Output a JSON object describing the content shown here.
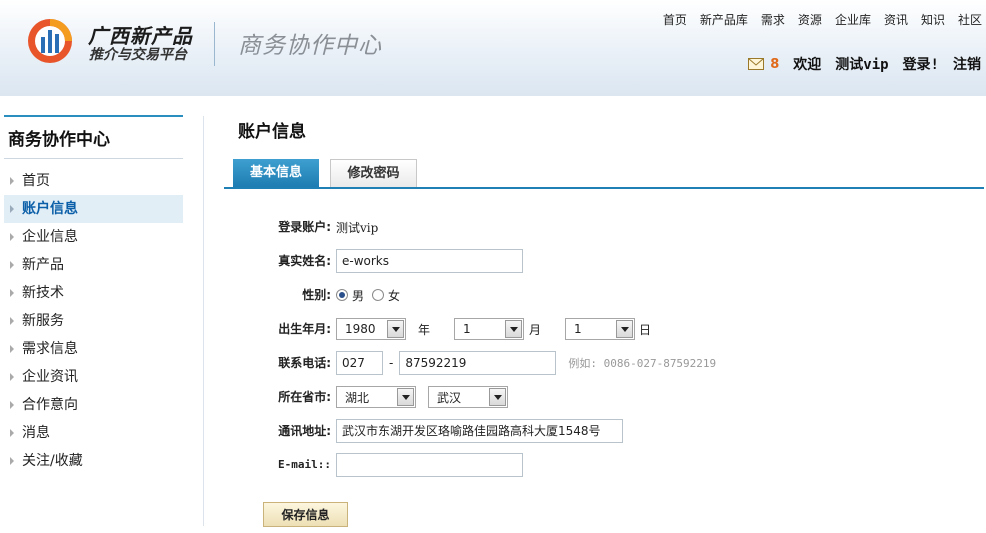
{
  "header": {
    "logo_title": "广西新产品",
    "logo_subtitle": "推介与交易平台",
    "center_title": "商务协作中心",
    "nav": [
      "首页",
      "新产品库",
      "需求",
      "资源",
      "企业库",
      "资讯",
      "知识",
      "社区"
    ],
    "user": {
      "mail_count": "8",
      "welcome": "欢迎",
      "username": "测试vip",
      "login_text": "登录!",
      "logout": "注销"
    }
  },
  "sidebar": {
    "title": "商务协作中心",
    "items": [
      "首页",
      "账户信息",
      "企业信息",
      "新产品",
      "新技术",
      "新服务",
      "需求信息",
      "企业资讯",
      "合作意向",
      "消息",
      "关注/收藏"
    ],
    "active_item": "账户信息"
  },
  "main": {
    "title": "账户信息",
    "tabs": [
      "基本信息",
      "修改密码"
    ],
    "active_tab": "基本信息"
  },
  "form": {
    "account": {
      "label": "登录账户:",
      "value": "测试vip"
    },
    "realname": {
      "label": "真实姓名:",
      "value": "e-works"
    },
    "gender": {
      "label": "性别:",
      "options": [
        "男",
        "女"
      ],
      "selected": "男"
    },
    "birth": {
      "label": "出生年月:",
      "year": "1980",
      "year_unit": "年",
      "month": "1",
      "month_unit": "月",
      "day": "1",
      "day_unit": "日"
    },
    "phone": {
      "label": "联系电话:",
      "area": "027",
      "separator": "-",
      "number": "87592219",
      "hint": "例如: 0086-027-87592219"
    },
    "location": {
      "label": "所在省市:",
      "province": "湖北",
      "city": "武汉"
    },
    "address": {
      "label": "通讯地址:",
      "value": "武汉市东湖开发区珞喻路佳园路高科大厦1548号"
    },
    "email": {
      "label": "E-mail::",
      "value": ""
    },
    "save_label": "保存信息"
  },
  "colors": {
    "accent_blue": "#1f80b5",
    "mail_count": "#e06a1a",
    "save_button": "#ede0b5"
  }
}
